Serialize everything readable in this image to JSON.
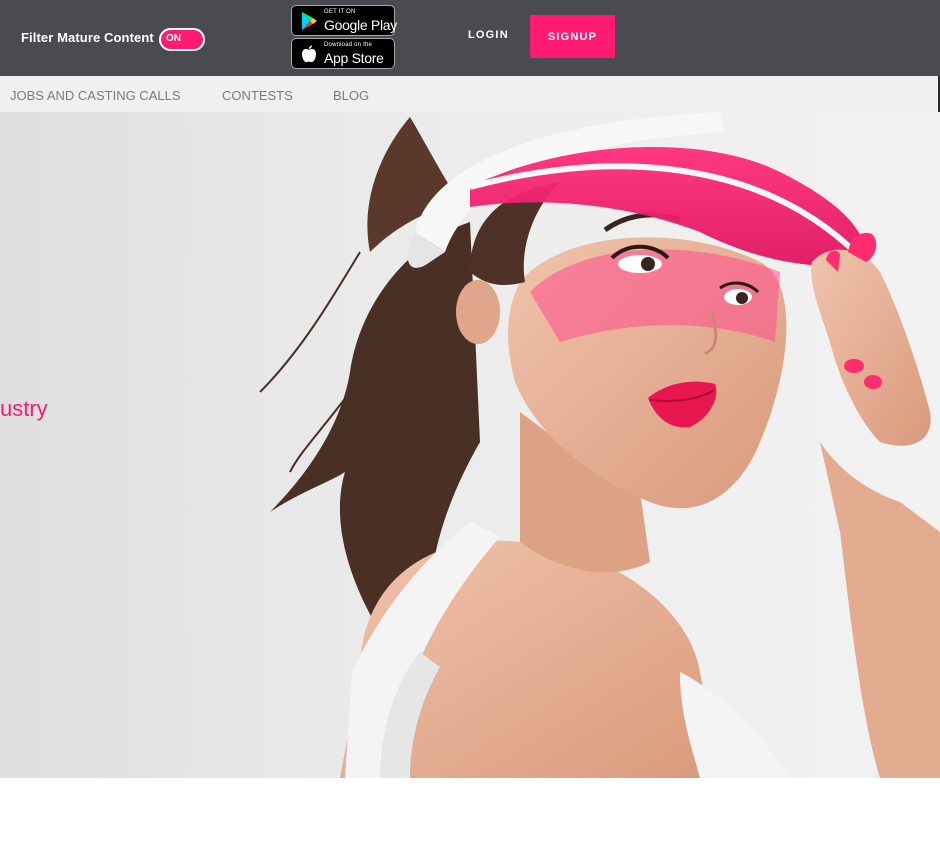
{
  "header": {
    "filter_label": "Filter Mature Content",
    "toggle_label": "ON",
    "google_play": {
      "small": "GET IT ON",
      "big": "Google Play"
    },
    "app_store": {
      "small": "Download on the",
      "big": "App Store"
    },
    "login_label": "LOGIN",
    "signup_label": "SIGNUP"
  },
  "nav": {
    "items": [
      {
        "label": "JOBS AND CASTING CALLS"
      },
      {
        "label": "CONTESTS"
      },
      {
        "label": "BLOG"
      }
    ]
  },
  "hero": {
    "text": "ustry"
  },
  "colors": {
    "accent": "#ff1a72",
    "topbar": "#4a4b50",
    "navbar": "#f0f0f0",
    "nav_text": "#7b7b7b"
  }
}
